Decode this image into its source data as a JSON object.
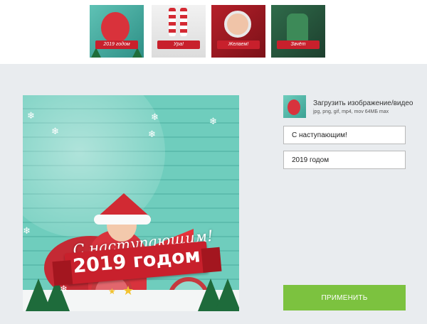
{
  "templates": [
    {
      "caption": "2019 годом",
      "selected": true
    },
    {
      "caption": "Ура!"
    },
    {
      "caption": "Желаем!"
    },
    {
      "caption": "Зачёт"
    }
  ],
  "preview": {
    "greeting_line1": "С наступающим!",
    "greeting_line2": "2019 годом"
  },
  "upload": {
    "label": "Загрузить изображение/видео",
    "hint": "jpg, png, gif, mp4, mov 64МБ max"
  },
  "fields": {
    "line1_value": "С наступающим!",
    "line2_value": "2019 годом"
  },
  "actions": {
    "apply_label": "ПРИМЕНИТЬ"
  },
  "colors": {
    "accent_green": "#7cc23f",
    "ribbon_red": "#c8202c",
    "background": "#e9ecef"
  }
}
